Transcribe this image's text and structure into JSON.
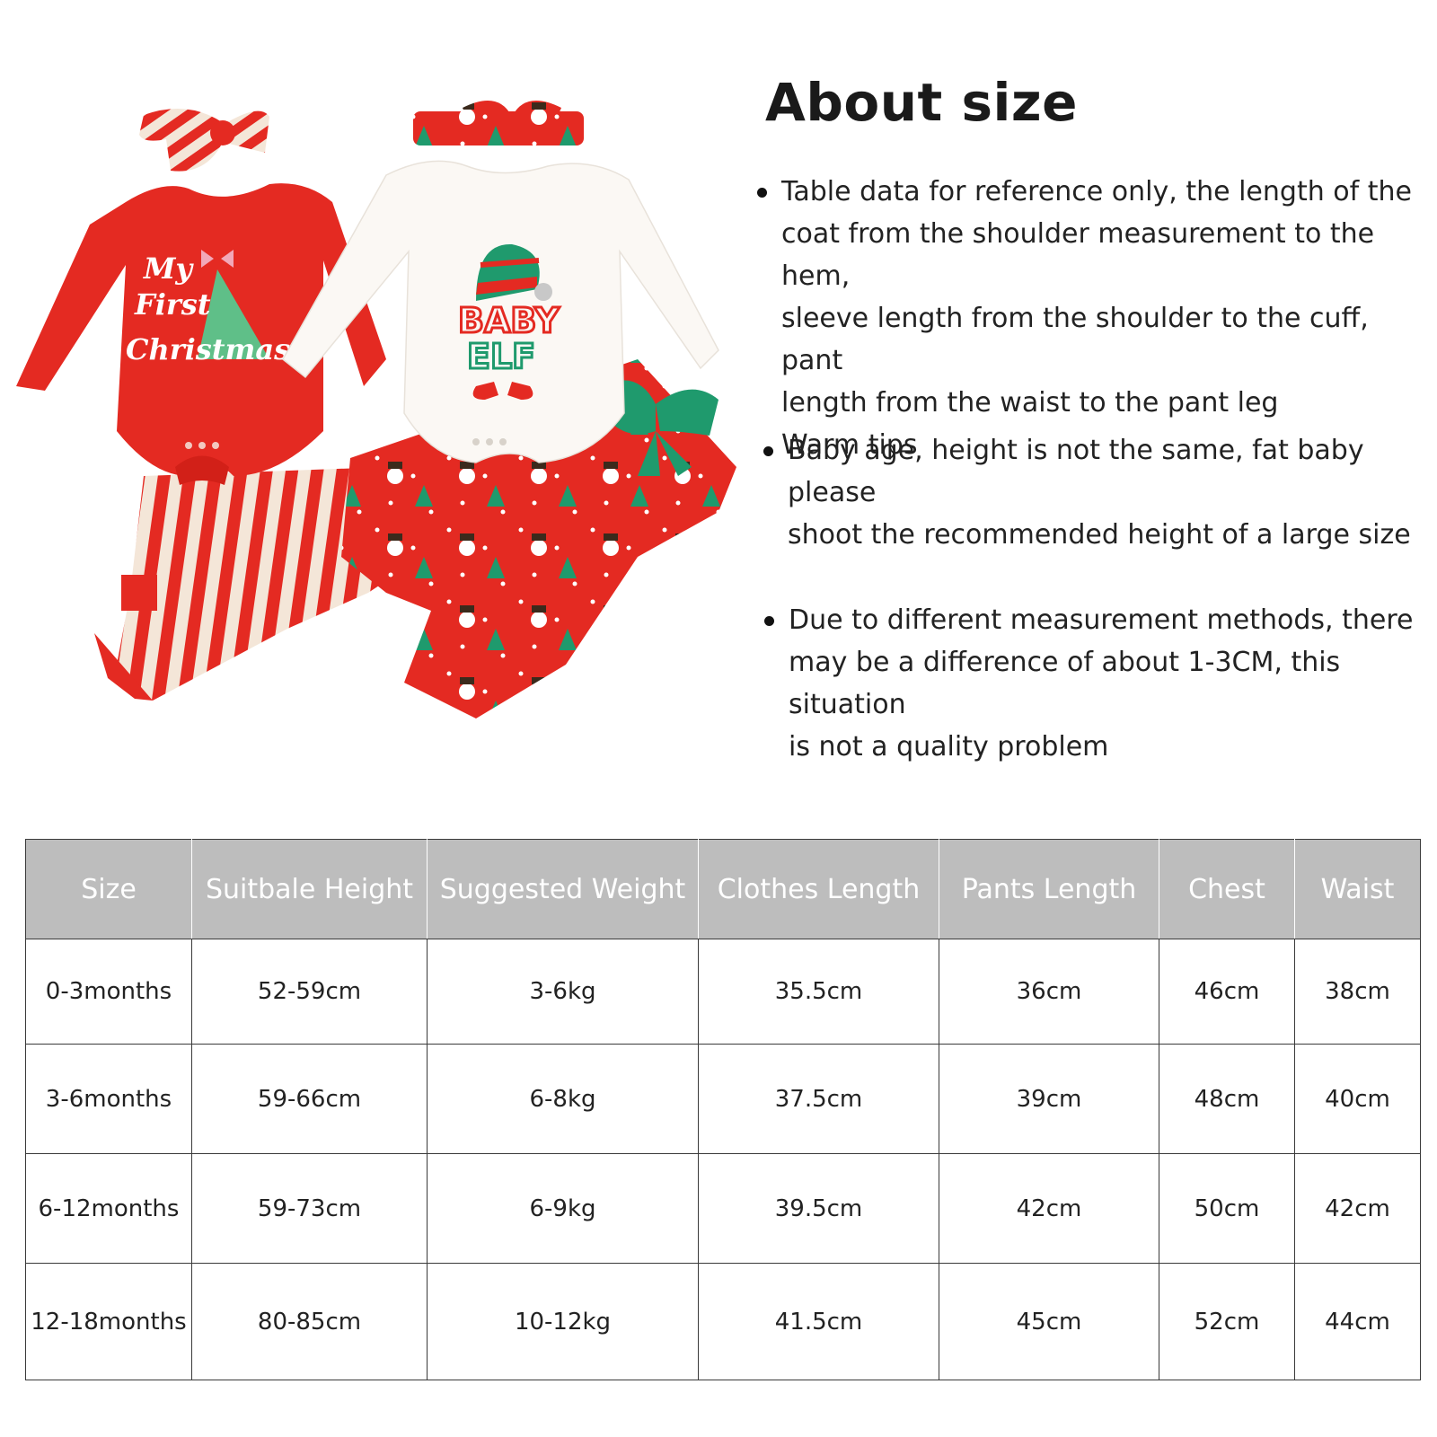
{
  "title": "About size",
  "notes": [
    {
      "lines": [
        "Table data for reference only, the length of the",
        "coat from the shoulder measurement to the hem,",
        "sleeve length from the shoulder to the cuff, pant",
        "length from the waist to the pant leg",
        "Warm tips"
      ]
    },
    {
      "lines": [
        "Baby age, height is not the same, fat baby please",
        "shoot the recommended height of a large size"
      ]
    },
    {
      "lines": [
        "Due to different measurement methods, there",
        "may be a difference of about 1-3CM, this situation",
        "is not a quality problem"
      ]
    }
  ],
  "product": {
    "red_bodysuit_print": [
      "My",
      "First",
      "Christmas"
    ],
    "white_bodysuit_print": [
      "BABY",
      "ELF"
    ],
    "colors": {
      "red": "#e42a22",
      "white": "#fbf8f4",
      "green": "#1f9a6d",
      "stripe_light": "#f4e6d8"
    }
  },
  "table": {
    "headers": [
      "Size",
      "Suitbale Height",
      "Suggested Weight",
      "Clothes Length",
      "Pants Length",
      "Chest",
      "Waist"
    ],
    "rows": [
      [
        "0-3months",
        "52-59cm",
        "3-6kg",
        "35.5cm",
        "36cm",
        "46cm",
        "38cm"
      ],
      [
        "3-6months",
        "59-66cm",
        "6-8kg",
        "37.5cm",
        "39cm",
        "48cm",
        "40cm"
      ],
      [
        "6-12months",
        "59-73cm",
        "6-9kg",
        "39.5cm",
        "42cm",
        "50cm",
        "42cm"
      ],
      [
        "12-18months",
        "80-85cm",
        "10-12kg",
        "41.5cm",
        "45cm",
        "52cm",
        "44cm"
      ]
    ],
    "header_bg": "#bdbdbd"
  }
}
